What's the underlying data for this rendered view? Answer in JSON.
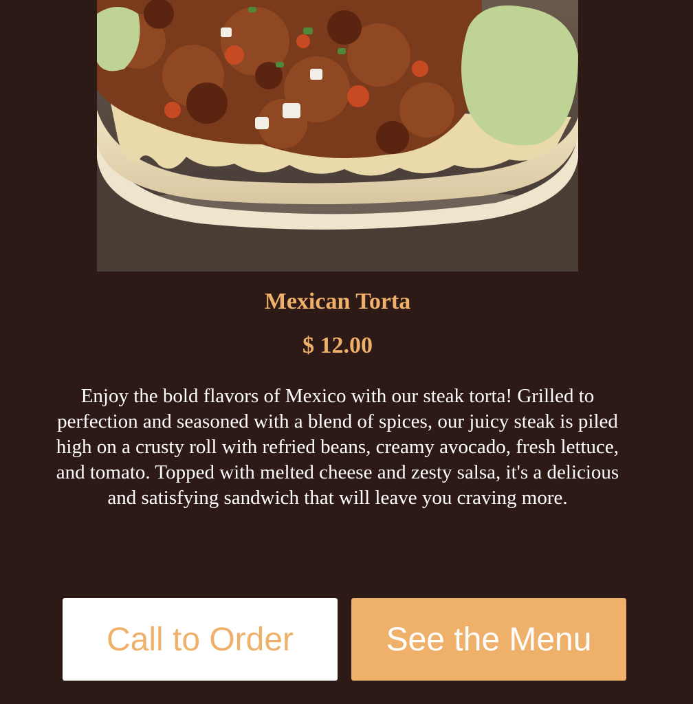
{
  "colors": {
    "background": "#2d1916",
    "accent": "#efb06a",
    "text": "#ffffff",
    "button_light": "#ffffff"
  },
  "item": {
    "photo_alt": "Mexican torta topped with grilled steak, guacamole and melted cheese",
    "name": "Mexican Torta",
    "price": "$ 12.00",
    "description": "Enjoy the bold flavors of Mexico with our steak torta! Grilled to perfection and seasoned with a blend of spices, our juicy steak is piled high on a crusty roll with refried beans, creamy avocado, fresh lettuce, and tomato. Topped with melted cheese and zesty salsa, it's a delicious and satisfying sandwich that will leave you craving more."
  },
  "actions": {
    "call_label": "Call to Order",
    "menu_label": "See the Menu"
  }
}
